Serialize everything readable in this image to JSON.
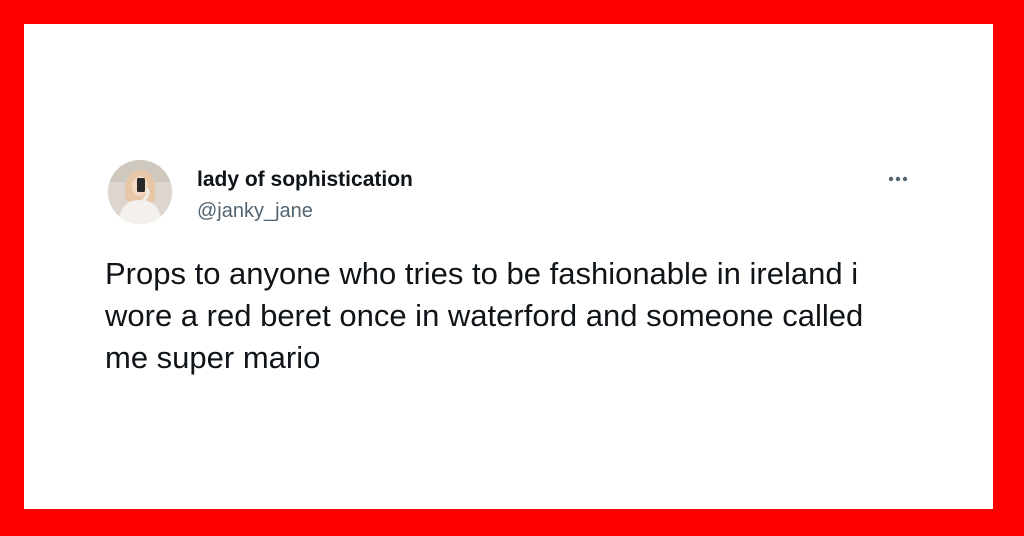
{
  "tweet": {
    "author_name": "lady of sophistication",
    "author_handle": "@janky_jane",
    "text": "Props to anyone who tries to be fashionable in ireland i wore a red beret once in waterford and someone called me super mario",
    "more_icon": "more-horizontal-icon"
  },
  "colors": {
    "frame": "#ff0000",
    "card": "#ffffff",
    "text": "#0f1419",
    "muted": "#536471"
  }
}
